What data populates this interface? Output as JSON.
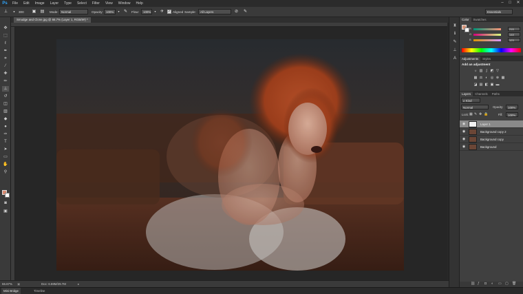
{
  "app": {
    "logo": "Ps",
    "menu": [
      "File",
      "Edit",
      "Image",
      "Layer",
      "Type",
      "Select",
      "Filter",
      "View",
      "Window",
      "Help"
    ],
    "window_controls": [
      "–",
      "□",
      "✕"
    ]
  },
  "options_bar": {
    "tool_icon": "clone-stamp-icon",
    "brush_size": "300",
    "mode_label": "Mode:",
    "mode_value": "Normal",
    "opacity_label": "Opacity:",
    "opacity_value": "100%",
    "flow_label": "Flow:",
    "flow_value": "100%",
    "aligned_label": "Aligned",
    "aligned_checked": true,
    "sample_label": "Sample:",
    "sample_value": "All Layers",
    "workspace": "Essentials"
  },
  "document": {
    "tab_title": "Smudge and Clone.jpg @ 66.7% (Layer 1, RGB/8#) *",
    "zoom": "66.67%",
    "doc_info": "Doc: 6.59M/29.7M"
  },
  "bottom_tabs": [
    "Mini Bridge",
    "Timeline"
  ],
  "color_panel": {
    "tabs": [
      "Color",
      "Swatches"
    ],
    "r_label": "R",
    "r_value": "215",
    "g_label": "G",
    "g_value": "148",
    "b_label": "B",
    "b_value": "123",
    "foreground_color": "#d79478"
  },
  "adjustments_panel": {
    "tabs": [
      "Adjustments",
      "Styles"
    ],
    "heading": "Add an adjustment"
  },
  "layers_panel": {
    "tabs": [
      "Layers",
      "Channels",
      "Paths"
    ],
    "filter_label": "ρ Kind",
    "blend_mode": "Normal",
    "opacity_label": "Opacity:",
    "opacity_value": "100%",
    "lock_label": "Lock:",
    "fill_label": "Fill:",
    "fill_value": "100%",
    "layers": [
      {
        "name": "Layer 1",
        "selected": true
      },
      {
        "name": "Background copy 2",
        "selected": false
      },
      {
        "name": "Background copy",
        "selected": false
      },
      {
        "name": "Background",
        "selected": false
      }
    ]
  }
}
